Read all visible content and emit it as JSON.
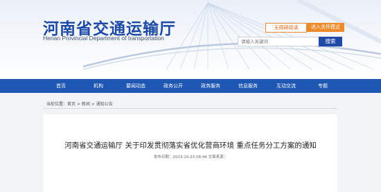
{
  "header": {
    "site_title": "河南省交通运输厅",
    "site_subtitle": "Henan Provincial Department of transportation",
    "accessibility_button": "无障碍阅读",
    "senior_mode_button": "进入关怀模式",
    "search_placeholder": "请输入关键词",
    "search_button": "搜索"
  },
  "nav": {
    "items": [
      {
        "label": "首页"
      },
      {
        "label": "机构"
      },
      {
        "label": "要闻动态"
      },
      {
        "label": "政务公开"
      },
      {
        "label": "政务服务"
      },
      {
        "label": "信息服务"
      },
      {
        "label": "互动交流"
      },
      {
        "label": "专题"
      }
    ]
  },
  "breadcrumb": {
    "prefix": "当前位置：",
    "home": "首页",
    "sep1": " > ",
    "news": "新闻",
    "sep2": " > ",
    "current": "通知公告"
  },
  "article": {
    "title": "河南省交通运输厅 关于印发贯彻落实省优化营商环境 重点任务分工方案的通知",
    "meta": "发布日期：2023-10-23 08:44   文章来源："
  },
  "colors": {
    "brand_blue": "#1e57b4",
    "title_blue": "#1d4aa6",
    "accent_orange": "#ef8a2a"
  }
}
